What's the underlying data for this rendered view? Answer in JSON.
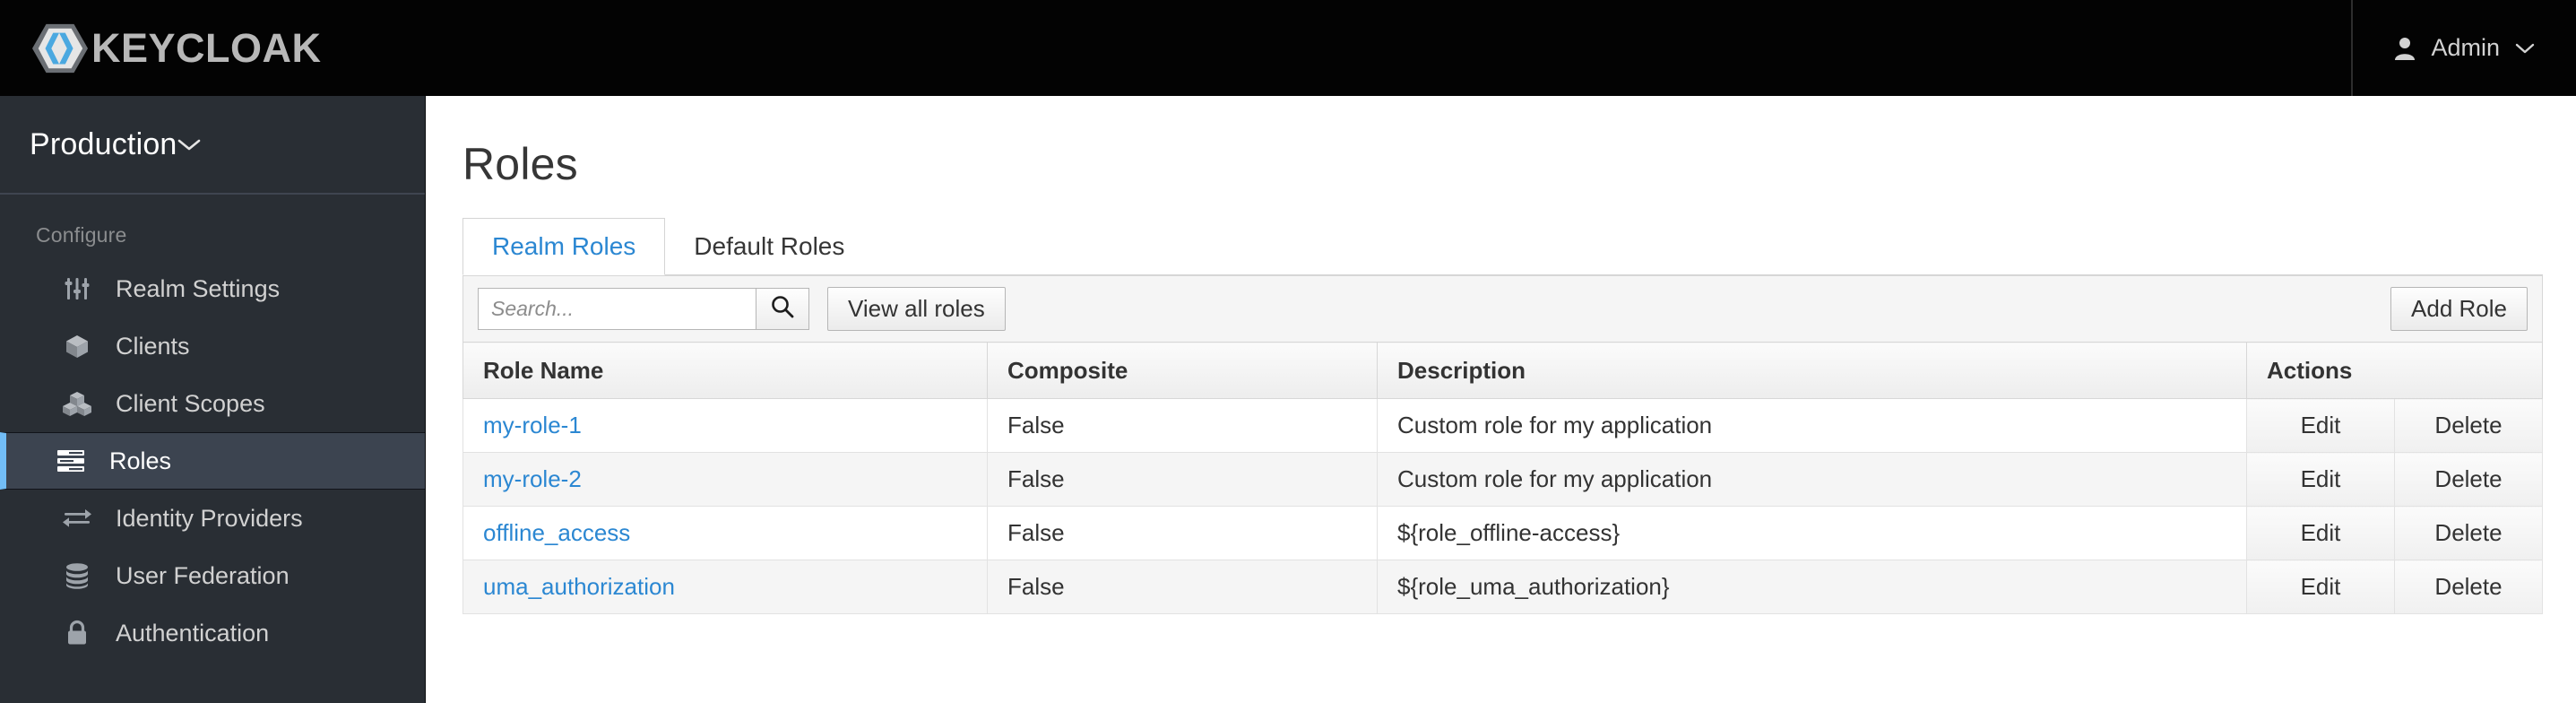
{
  "masthead": {
    "brand_name": "KEYCLOAK",
    "brand_logo_icon": "keycloak-hexagon-logo",
    "user_icon": "user-icon",
    "user_label": "Admin",
    "user_caret_icon": "chevron-down-icon",
    "background_color": "#030303",
    "brand_text_color": "#b8b8b8"
  },
  "sidebar": {
    "realm": {
      "name": "Production",
      "caret_icon": "chevron-down-icon"
    },
    "section_label": "Configure",
    "active_accent_color": "#72bdf6",
    "background_color": "#292e34",
    "items": [
      {
        "label": "Realm Settings",
        "icon": "sliders-icon",
        "active": false
      },
      {
        "label": "Clients",
        "icon": "cube-icon",
        "active": false
      },
      {
        "label": "Client Scopes",
        "icon": "cubes-icon",
        "active": false
      },
      {
        "label": "Roles",
        "icon": "list-bars-icon",
        "active": true
      },
      {
        "label": "Identity Providers",
        "icon": "exchange-arrows-icon",
        "active": false
      },
      {
        "label": "User Federation",
        "icon": "database-icon",
        "active": false
      },
      {
        "label": "Authentication",
        "icon": "lock-icon",
        "active": false
      }
    ]
  },
  "main": {
    "page_title": "Roles",
    "tabs": [
      {
        "label": "Realm Roles",
        "active": true
      },
      {
        "label": "Default Roles",
        "active": false
      }
    ],
    "toolbar": {
      "search_placeholder": "Search...",
      "search_value": "",
      "search_icon": "search-icon",
      "view_all_label": "View all roles",
      "add_role_label": "Add Role"
    },
    "table": {
      "columns": [
        "Role Name",
        "Composite",
        "Description",
        "Actions"
      ],
      "rows": [
        {
          "name": "my-role-1",
          "composite": "False",
          "description": "Custom role for my application",
          "edit": "Edit",
          "delete": "Delete"
        },
        {
          "name": "my-role-2",
          "composite": "False",
          "description": "Custom role for my application",
          "edit": "Edit",
          "delete": "Delete"
        },
        {
          "name": "offline_access",
          "composite": "False",
          "description": "${role_offline-access}",
          "edit": "Edit",
          "delete": "Delete"
        },
        {
          "name": "uma_authorization",
          "composite": "False",
          "description": "${role_uma_authorization}",
          "edit": "Edit",
          "delete": "Delete"
        }
      ]
    },
    "link_color": "#2b87d2"
  }
}
